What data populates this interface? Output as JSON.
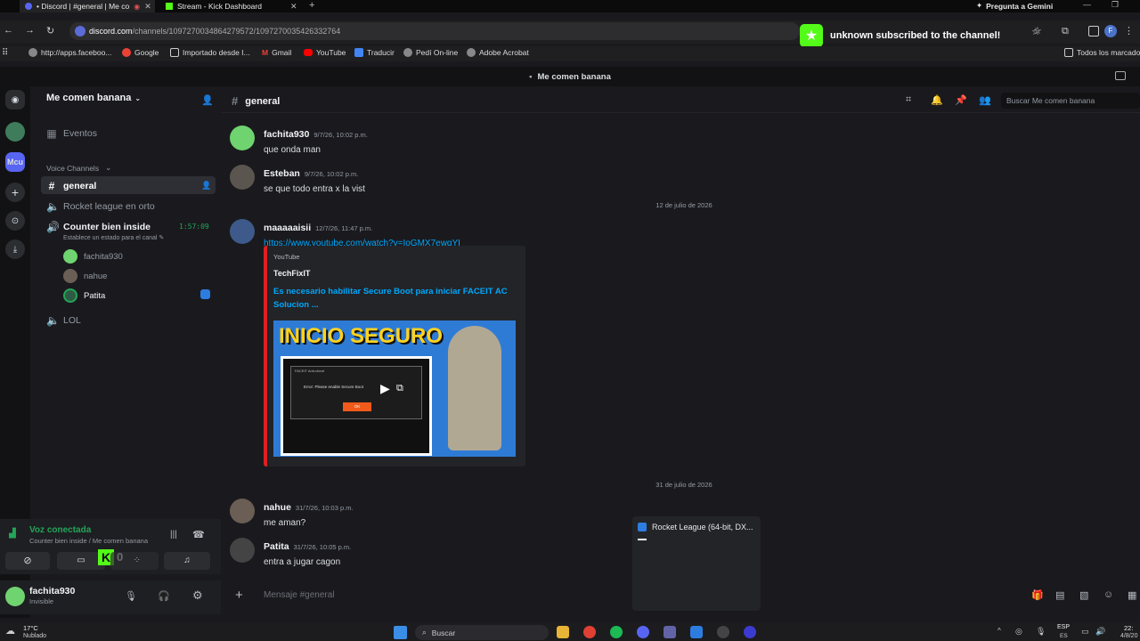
{
  "browser": {
    "tabs": [
      {
        "label": "• Discord | #general | Me co",
        "active": true
      },
      {
        "label": "Stream - Kick Dashboard",
        "active": false
      }
    ],
    "gemini_label": "Pregunta a Gemini",
    "url_domain": "discord.com",
    "url_path": "/channels/1097270034864279572/1097270035426332764",
    "bookmarks": [
      "http://apps.faceboo...",
      "Google",
      "Importado desde I...",
      "Gmail",
      "YouTube",
      "Traducir",
      "Pedí On-line",
      "Adobe Acrobat",
      "Todos los marcado"
    ]
  },
  "toast": {
    "text": "unknown subscribed to the channel!"
  },
  "discord": {
    "window_title": "Me comen banana",
    "server_name": "Me comen banana",
    "guild_label": "Mcu",
    "sidebar": {
      "events": "Eventos",
      "voice_section": "Voice Channels",
      "channels": {
        "general": "general",
        "rocket": "Rocket league en orto",
        "counter": "Counter bien inside",
        "counter_timer": "1:57:09",
        "counter_status": "Establece un estado para el canal",
        "lol": "LOL"
      },
      "voice_users": [
        "fachita930",
        "nahue",
        "Patita"
      ]
    },
    "voice_panel": {
      "status": "Voz conectada",
      "location": "Counter bien inside / Me comen banana",
      "kick_count": "0"
    },
    "user_panel": {
      "name": "fachita930",
      "status": "Invisible"
    },
    "channel_header": {
      "name": "general",
      "search_placeholder": "Buscar Me comen banana"
    },
    "messages": [
      {
        "user": "fachita930",
        "time": "9/7/26, 10:02 p.m.",
        "text": "que onda man"
      },
      {
        "user": "Esteban",
        "time": "9/7/26, 10:02 p.m.",
        "text": "se que todo entra x la vist"
      },
      {
        "date_divider": "12 de julio de 2026"
      },
      {
        "user": "maaaaaisii",
        "time": "12/7/26, 11:47 p.m.",
        "text": "https://www.youtube.com/watch?v=IoGMX7ewqYI"
      },
      {
        "date_divider": "31 de julio de 2026"
      },
      {
        "user": "nahue",
        "time": "31/7/26, 10:03 p.m.",
        "text": "me aman?"
      },
      {
        "user": "Patita",
        "time": "31/7/26, 10:05 p.m.",
        "text": "entra a jugar cagon"
      }
    ],
    "embed": {
      "provider": "YouTube",
      "author": "TechFixIT",
      "title": "Es necesario habilitar Secure Boot para iniciar FACEIT AC Solucion ...",
      "thumb_text": "INICIO SEGURO",
      "dialog_title": "FACEIT Anti-cheat",
      "dialog_text": "Error: Please enable Secure Boot",
      "dialog_button": "OK"
    },
    "composer_placeholder": "Mensaje #general",
    "game_popup": "Rocket League (64-bit, DX..."
  },
  "taskbar": {
    "weather_temp": "17°C",
    "weather_desc": "Nublado",
    "search": "Buscar",
    "lang": "ESP",
    "lang2": "ES",
    "clock_time": "22:",
    "clock_date": "4/8/20"
  },
  "colors": {
    "discord_bg": "#1a1a1e",
    "kick_green": "#53fc18",
    "link": "#00a8fc",
    "embed_bar": "#e02020"
  }
}
